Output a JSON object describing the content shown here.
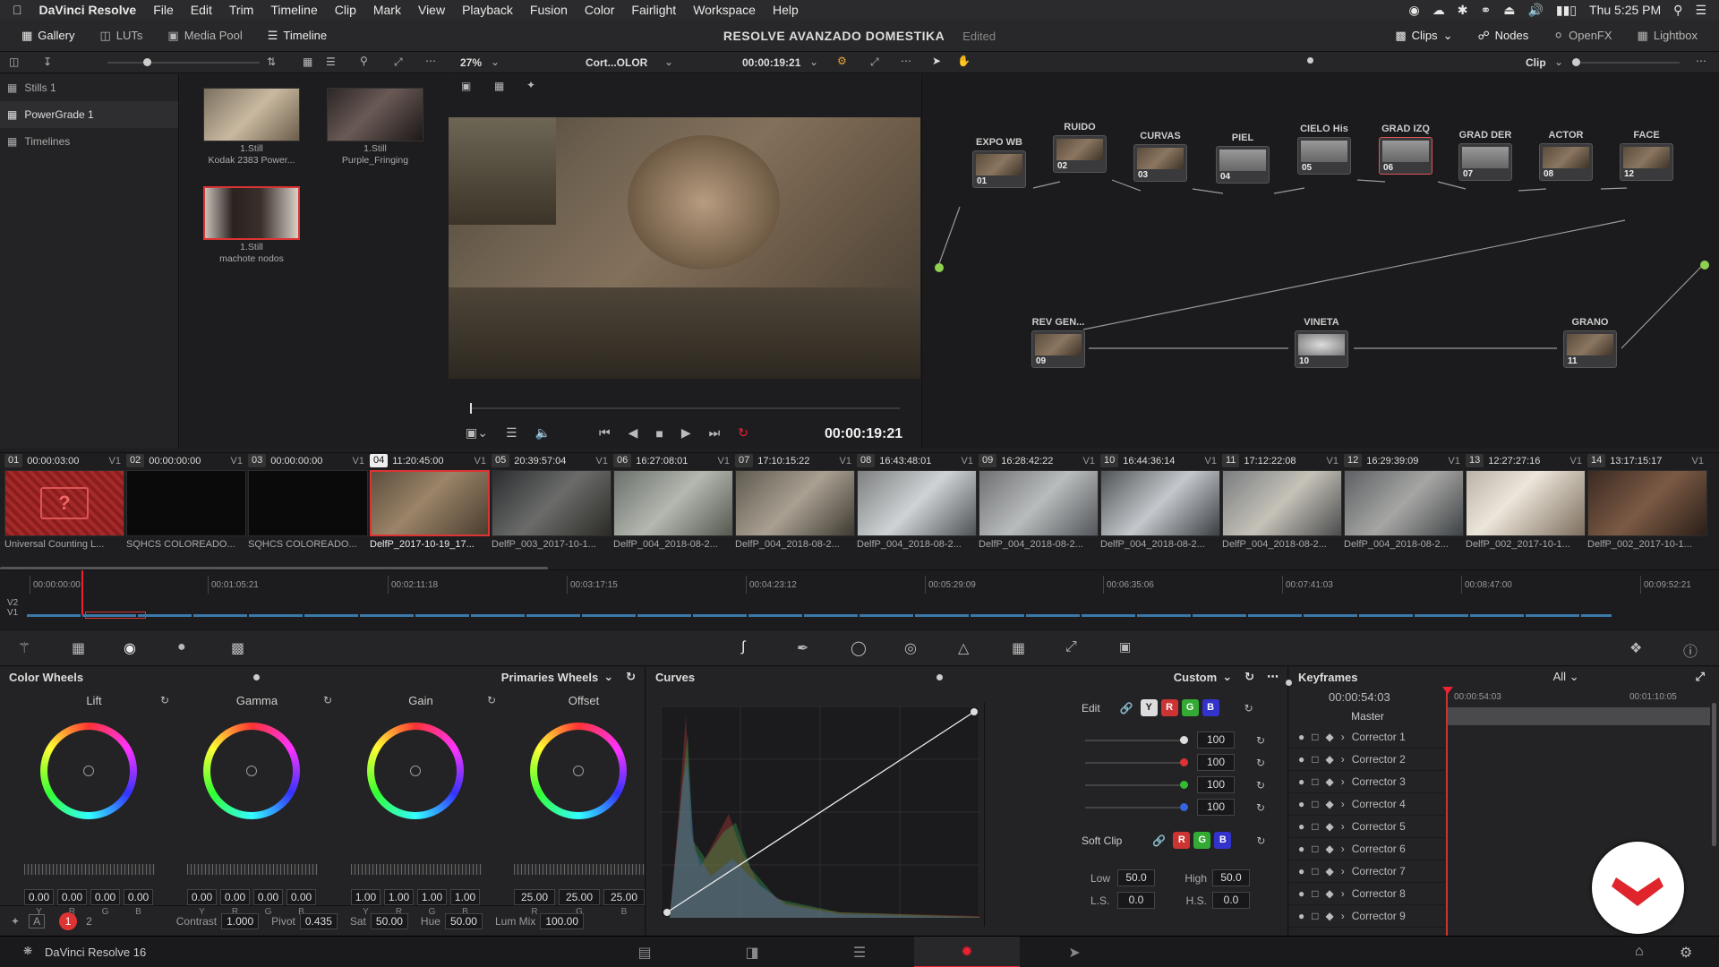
{
  "menubar": {
    "apple": "",
    "app": "DaVinci Resolve",
    "items": [
      "File",
      "Edit",
      "Trim",
      "Timeline",
      "Clip",
      "Mark",
      "View",
      "Playback",
      "Fusion",
      "Color",
      "Fairlight",
      "Workspace",
      "Help"
    ],
    "clock": "Thu 5:25 PM"
  },
  "toolbar": {
    "gallery": "Gallery",
    "luts": "LUTs",
    "media_pool": "Media Pool",
    "timeline": "Timeline",
    "project": "RESOLVE AVANZADO DOMESTIKA",
    "edited": "Edited",
    "clips": "Clips",
    "nodes": "Nodes",
    "openfx": "OpenFX",
    "lightbox": "Lightbox"
  },
  "viewer": {
    "zoom": "27%",
    "clip_name": "Cort...OLOR",
    "timecode_top": "00:00:19:21",
    "timecode": "00:00:19:21",
    "mode": "Clip"
  },
  "gallery": {
    "albums": [
      "Stills 1",
      "PowerGrade 1",
      "Timelines"
    ],
    "stills": [
      {
        "label": "1.Still",
        "name": "Kodak 2383 Power..."
      },
      {
        "label": "1.Still",
        "name": "Purple_Fringing"
      },
      {
        "label": "1.Still",
        "name": "machote nodos"
      }
    ]
  },
  "nodes": [
    {
      "label": "EXPO WB",
      "num": "01"
    },
    {
      "label": "RUIDO",
      "num": "02"
    },
    {
      "label": "CURVAS",
      "num": "03"
    },
    {
      "label": "PIEL",
      "num": "04"
    },
    {
      "label": "CIELO His",
      "num": "05"
    },
    {
      "label": "GRAD IZQ",
      "num": "06"
    },
    {
      "label": "GRAD DER",
      "num": "07"
    },
    {
      "label": "ACTOR",
      "num": "08"
    },
    {
      "label": "FACE",
      "num": "12"
    },
    {
      "label": "REV GEN...",
      "num": "09"
    },
    {
      "label": "VINETA",
      "num": "10"
    },
    {
      "label": "GRANO",
      "num": "11"
    }
  ],
  "clips": [
    {
      "num": "01",
      "tc": "00:00:03:00",
      "track": "V1",
      "name": "Universal Counting L..."
    },
    {
      "num": "02",
      "tc": "00:00:00:00",
      "track": "V1",
      "name": "SQHCS COLOREADO..."
    },
    {
      "num": "03",
      "tc": "00:00:00:00",
      "track": "V1",
      "name": "SQHCS COLOREADO..."
    },
    {
      "num": "04",
      "tc": "11:20:45:00",
      "track": "V1",
      "name": "DelfP_2017-10-19_17..."
    },
    {
      "num": "05",
      "tc": "20:39:57:04",
      "track": "V1",
      "name": "DelfP_003_2017-10-1..."
    },
    {
      "num": "06",
      "tc": "16:27:08:01",
      "track": "V1",
      "name": "DelfP_004_2018-08-2..."
    },
    {
      "num": "07",
      "tc": "17:10:15:22",
      "track": "V1",
      "name": "DelfP_004_2018-08-2..."
    },
    {
      "num": "08",
      "tc": "16:43:48:01",
      "track": "V1",
      "name": "DelfP_004_2018-08-2..."
    },
    {
      "num": "09",
      "tc": "16:28:42:22",
      "track": "V1",
      "name": "DelfP_004_2018-08-2..."
    },
    {
      "num": "10",
      "tc": "16:44:36:14",
      "track": "V1",
      "name": "DelfP_004_2018-08-2..."
    },
    {
      "num": "11",
      "tc": "17:12:22:08",
      "track": "V1",
      "name": "DelfP_004_2018-08-2..."
    },
    {
      "num": "12",
      "tc": "16:29:39:09",
      "track": "V1",
      "name": "DelfP_004_2018-08-2..."
    },
    {
      "num": "13",
      "tc": "12:27:27:16",
      "track": "V1",
      "name": "DelfP_002_2017-10-1..."
    },
    {
      "num": "14",
      "tc": "13:17:15:17",
      "track": "V1",
      "name": "DelfP_002_2017-10-1..."
    }
  ],
  "mini_timeline": {
    "ruler": [
      "00:00:00:00",
      "00:01:05:21",
      "00:02:11:18",
      "00:03:17:15",
      "00:04:23:12",
      "00:05:29:09",
      "00:06:35:06",
      "00:07:41:03",
      "00:08:47:00",
      "00:09:52:21"
    ],
    "tracks": [
      "V2",
      "V1"
    ]
  },
  "wheels": {
    "title": "Color Wheels",
    "mode": "Primaries Wheels",
    "items": [
      {
        "name": "Lift",
        "values": [
          "0.00",
          "0.00",
          "0.00",
          "0.00"
        ],
        "channels": [
          "Y",
          "R",
          "G",
          "B"
        ]
      },
      {
        "name": "Gamma",
        "values": [
          "0.00",
          "0.00",
          "0.00",
          "0.00"
        ],
        "channels": [
          "Y",
          "R",
          "G",
          "B"
        ]
      },
      {
        "name": "Gain",
        "values": [
          "1.00",
          "1.00",
          "1.00",
          "1.00"
        ],
        "channels": [
          "Y",
          "R",
          "G",
          "B"
        ]
      },
      {
        "name": "Offset",
        "values": [
          "25.00",
          "25.00",
          "25.00"
        ],
        "channels": [
          "R",
          "G",
          "B"
        ]
      }
    ],
    "footer": {
      "page1": "1",
      "page2": "2",
      "contrast_label": "Contrast",
      "contrast": "1.000",
      "pivot_label": "Pivot",
      "pivot": "0.435",
      "sat_label": "Sat",
      "sat": "50.00",
      "hue_label": "Hue",
      "hue": "50.00",
      "lummix_label": "Lum Mix",
      "lummix": "100.00"
    }
  },
  "curves": {
    "title": "Curves",
    "mode": "Custom",
    "edit_label": "Edit",
    "channels": [
      "Y",
      "R",
      "G",
      "B"
    ],
    "intensity": [
      "100",
      "100",
      "100",
      "100"
    ],
    "softclip_label": "Soft Clip",
    "low_label": "Low",
    "low": "50.0",
    "high_label": "High",
    "high": "50.0",
    "ls_label": "L.S.",
    "ls": "0.0",
    "hs_label": "H.S.",
    "hs": "0.0"
  },
  "keyframes": {
    "title": "Keyframes",
    "filter": "All",
    "tc": "00:00:54:03",
    "ruler1": "00:00:54:03",
    "ruler2": "00:01:10:05",
    "master": "Master",
    "rows": [
      "Corrector 1",
      "Corrector 2",
      "Corrector 3",
      "Corrector 4",
      "Corrector 5",
      "Corrector 6",
      "Corrector 7",
      "Corrector 8",
      "Corrector 9"
    ]
  },
  "footer": {
    "version": "DaVinci Resolve 16"
  },
  "colors": {
    "accent": "#e0242c",
    "panel": "#232325",
    "node_link": "#8fd14f"
  }
}
